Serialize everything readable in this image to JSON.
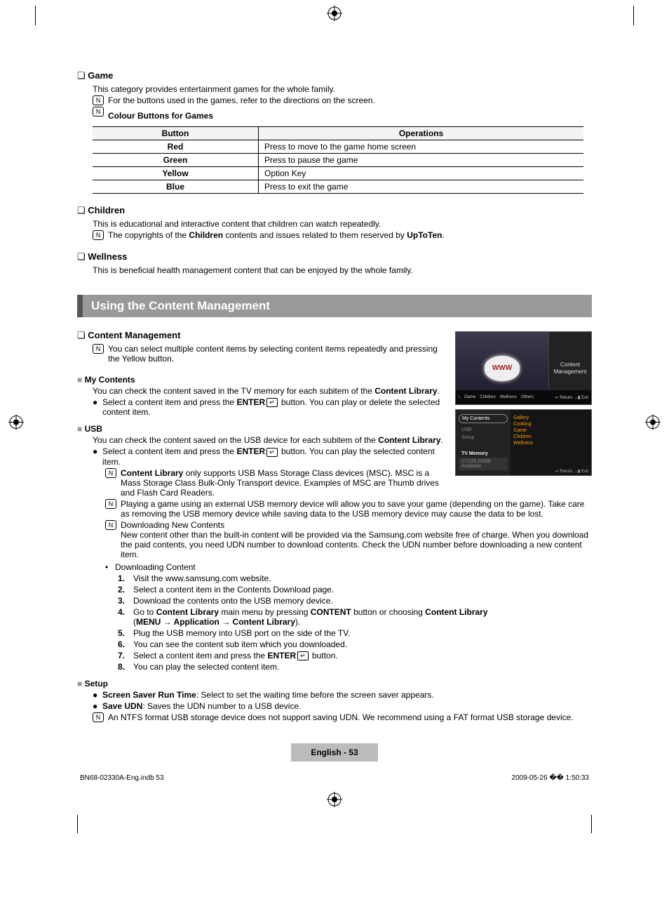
{
  "game": {
    "title": "Game",
    "desc": "This category provides entertainment games for the whole family.",
    "note1": "For the buttons used in the games, refer to the directions on the screen.",
    "subhead": "Colour Buttons for Games",
    "table": {
      "h1": "Button",
      "h2": "Operations",
      "rows": [
        {
          "b": "Red",
          "o": "Press to move to the game home screen"
        },
        {
          "b": "Green",
          "o": "Press to pause the game"
        },
        {
          "b": "Yellow",
          "o": "Option Key"
        },
        {
          "b": "Blue",
          "o": "Press to exit the game"
        }
      ]
    }
  },
  "children": {
    "title": "Children",
    "desc": "This is educational and interactive content that children can watch repeatedly.",
    "note_pre": "The copyrights of the ",
    "note_bold": "Children",
    "note_mid": " contents and issues related to them reserved by ",
    "note_bold2": "UpToTen",
    "note_post": "."
  },
  "wellness": {
    "title": "Wellness",
    "desc": "This is beneficial health management content that can be enjoyed by the whole family."
  },
  "ucm": {
    "title": "Using the Content Management"
  },
  "cm": {
    "title": "Content Management",
    "note": "You can select multiple content items by selecting content items repeatedly and pressing the Yellow button."
  },
  "mycontents": {
    "title": "My Contents",
    "l1_pre": "You can check the content saved in the TV memory for each subitem of the ",
    "l1_bold": "Content Library",
    "l1_post": ".",
    "b1_pre": "Select a content item and press the ",
    "b1_bold": "ENTER",
    "b1_post": " button. You can play or delete the selected content item."
  },
  "usb": {
    "title": "USB",
    "l1_pre": "You can check the content saved on the USB device for each subitem of the ",
    "l1_bold": "Content Library",
    "l1_post": ".",
    "b1_pre": "Select a content item and press the ",
    "b1_bold": "ENTER",
    "b1_post": " button. You can play the selected content item.",
    "n1_bold": "Content Library",
    "n1_post": " only supports USB Mass Storage Class devices (MSC). MSC is a Mass Storage Class Bulk-Only Transport device. Examples of MSC are Thumb drives and Flash Card Readers.",
    "n2": "Playing a game using an external USB memory device will allow you to save your game (depending on the game). Take care as removing the USB memory device while saving data to the USB memory device may cause the data to be lost.",
    "n3_title": "Downloading New Contents",
    "n3_body": "New content other than the built-in content will be provided via the Samsung.com website free of charge. When you download the paid contents, you need UDN number to download contents. Check the UDN number before downloading a new content item.",
    "dc_title": "Downloading Content",
    "steps": {
      "s1": "Visit the www.samsung.com website.",
      "s2": "Select a content item in the Contents Download page.",
      "s3": "Download the contents onto the USB memory device.",
      "s4_pre": "Go to ",
      "s4_b1": "Content Library",
      "s4_mid1": " main menu by pressing ",
      "s4_b2": "CONTENT",
      "s4_mid2": " button or choosing ",
      "s4_b3": "Content Library",
      "s4_line2_pre": "(",
      "s4_line2_path": "MENU → Application → Content Library",
      "s4_line2_post": ").",
      "s5": "Plug the USB memory into USB port on the side of the TV.",
      "s6": "You can see the content sub item which you downloaded.",
      "s7_pre": "Select a content item and press the ",
      "s7_bold": "ENTER",
      "s7_post": " button.",
      "s8": "You can play the selected content item."
    }
  },
  "setup": {
    "title": "Setup",
    "l1_bold": "Screen Saver Run Time",
    "l1_post": ": Select to set the waiting time before the screen saver appears.",
    "l2_bold": "Save UDN",
    "l2_post": ": Saves the UDN number to a USB device.",
    "note": "An NTFS format USB storage device does not support saving UDN. We recommend using a FAT format USB storage device."
  },
  "footer": {
    "pagelabel": "English - 53",
    "printfile": "BN68-02330A-Eng.indb   53",
    "printtime": "2009-05-26   �� 1:50:33"
  },
  "mock": {
    "cm_label": "Content Management",
    "www": "WWW",
    "bot_items": [
      "Game",
      "Children",
      "Wellness",
      "Others",
      "Content Management"
    ],
    "bot_right": "↩ Return   →▮ Exit",
    "b_header": "My Contents",
    "b_left": [
      "USB",
      "Setup"
    ],
    "b_tv": "TV Memory",
    "b_tvline": "17/189.00MB Available",
    "b_right": [
      "Gallery",
      "Cooking",
      "Game",
      "Children",
      "Wellness"
    ],
    "b_foot": "↩ Return   →▮ Exit"
  }
}
